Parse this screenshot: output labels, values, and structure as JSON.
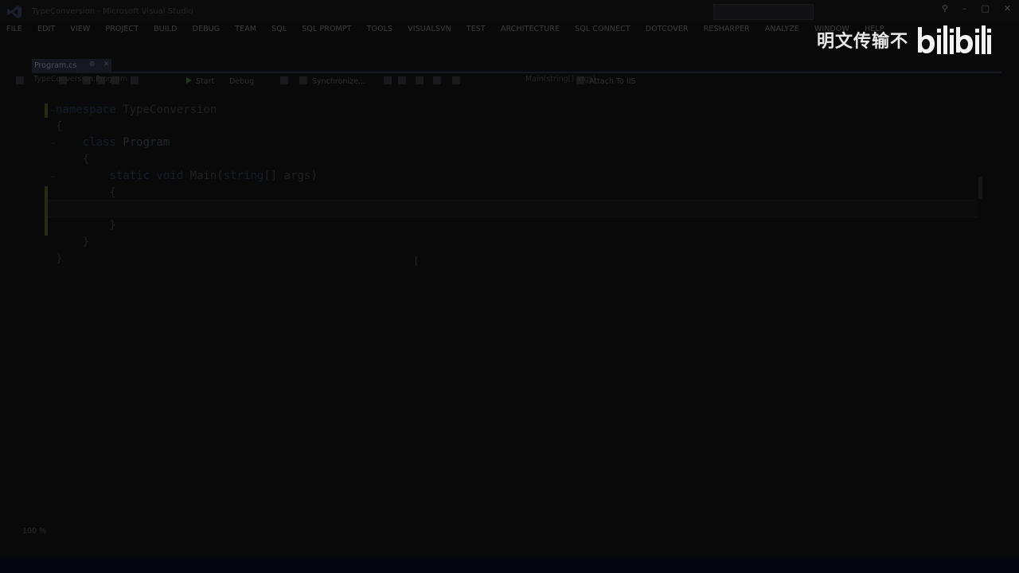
{
  "window": {
    "title": "TypeConversion - Microsoft Visual Studio"
  },
  "menu": [
    "FILE",
    "EDIT",
    "VIEW",
    "PROJECT",
    "BUILD",
    "DEBUG",
    "TEAM",
    "SQL",
    "SQL PROMPT",
    "TOOLS",
    "VISUALSVN",
    "TEST",
    "ARCHITECTURE",
    "SQL CONNECT",
    "DOTCOVER",
    "RESHARPER",
    "ANALYZE",
    "WINDOW",
    "HELP"
  ],
  "toolbar": {
    "start_label": "Start",
    "config": "Debug",
    "sync_label": "Synchronize...",
    "attach_label": "Attach To IIS"
  },
  "tab": {
    "label": "Program.cs"
  },
  "navigation": {
    "left": "TypeConversion.Program",
    "right": "Main(string[] args)"
  },
  "code": [
    {
      "tokens": [
        {
          "t": "namespace ",
          "c": "kw"
        },
        {
          "t": "TypeConversion",
          "c": ""
        }
      ]
    },
    {
      "tokens": [
        {
          "t": "{",
          "c": ""
        }
      ]
    },
    {
      "tokens": [
        {
          "t": "    class ",
          "c": "kw"
        },
        {
          "t": "Program",
          "c": "cls"
        }
      ]
    },
    {
      "tokens": [
        {
          "t": "    {",
          "c": ""
        }
      ]
    },
    {
      "tokens": [
        {
          "t": "        static void ",
          "c": "kw"
        },
        {
          "t": "Main(",
          "c": ""
        },
        {
          "t": "string",
          "c": "kw"
        },
        {
          "t": "[] args)",
          "c": ""
        }
      ]
    },
    {
      "tokens": [
        {
          "t": "        {",
          "c": ""
        }
      ]
    },
    {
      "tokens": [
        {
          "t": "",
          "c": ""
        }
      ]
    },
    {
      "tokens": [
        {
          "t": "        }",
          "c": ""
        }
      ]
    },
    {
      "tokens": [
        {
          "t": "    }",
          "c": ""
        }
      ]
    },
    {
      "tokens": [
        {
          "t": "}",
          "c": ""
        }
      ]
    }
  ],
  "editor": {
    "zoom": "100 %"
  },
  "watermark": {
    "text": "明文传输不",
    "logo": "bilibili"
  }
}
